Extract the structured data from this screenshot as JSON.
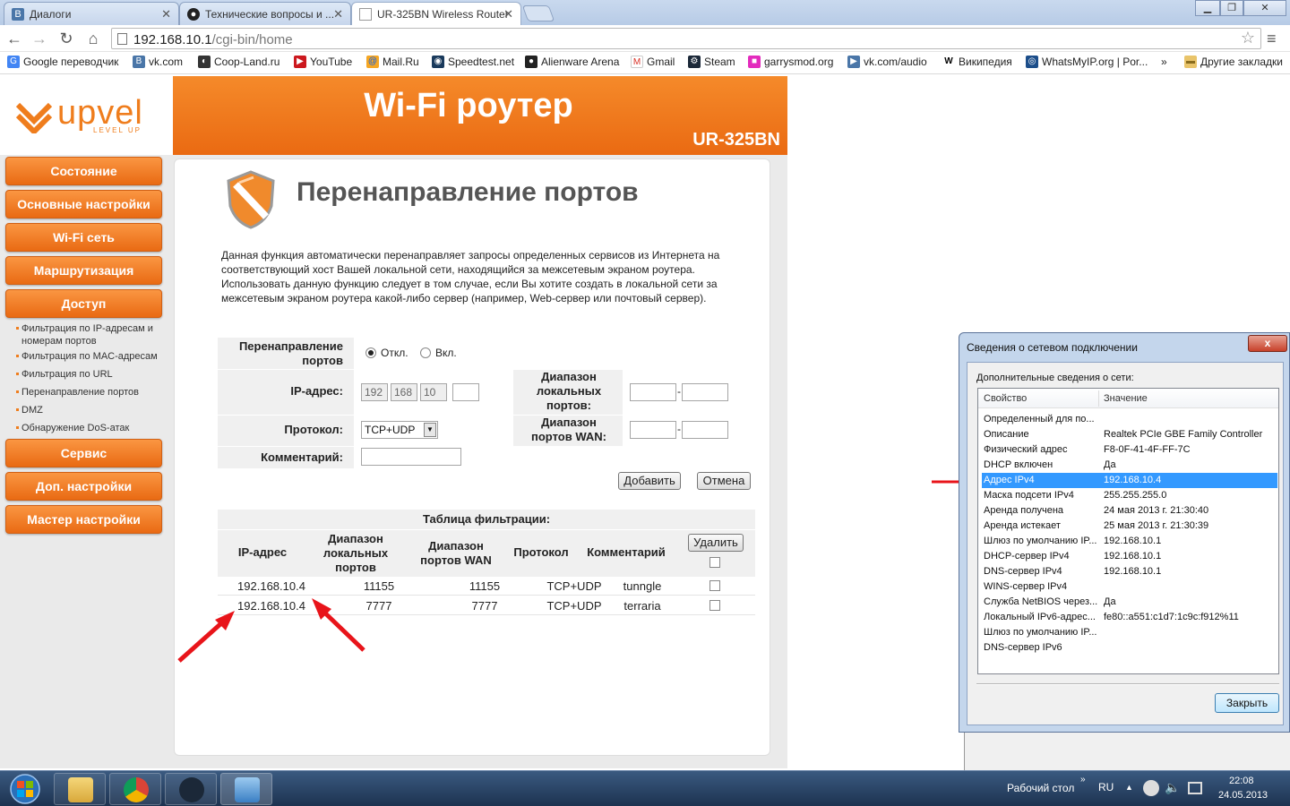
{
  "browser": {
    "tabs": [
      {
        "title": "Диалоги",
        "icon": "vk-icon"
      },
      {
        "title": "Технические вопросы и ...",
        "icon": "steam-icon"
      },
      {
        "title": "UR-325BN Wireless Router",
        "icon": "page-icon"
      }
    ],
    "url_host": "192.168.10.1",
    "url_path": "/cgi-bin/home",
    "bookmarks": [
      "Google переводчик",
      "vk.com",
      "Coop-Land.ru",
      "YouTube",
      "Mail.Ru",
      "Speedtest.net",
      "Alienware Arena",
      "Gmail",
      "Steam",
      "garrysmod.org",
      "vk.com/audio",
      "Википедия",
      "WhatsMyIP.org | Por...",
      "»",
      "Другие закладки"
    ]
  },
  "router": {
    "logo": "upvel",
    "logo_sub": "LEVEL UP",
    "header_title": "Wi-Fi роутер",
    "model": "UR-325BN",
    "menu": [
      "Состояние",
      "Основные настройки",
      "Wi-Fi сеть",
      "Маршрутизация",
      "Доступ"
    ],
    "submenu": [
      "Фильтрация по IP-адресам и номерам портов",
      "Фильтрация по MAC-адресам",
      "Фильтрация по URL",
      "Перенаправление портов",
      "DMZ",
      "Обнаружение DoS-атак"
    ],
    "menu2": [
      "Сервис",
      "Доп. настройки",
      "Мастер настройки"
    ],
    "page_title": "Перенаправление портов",
    "description": "Данная функция автоматически перенаправляет запросы определенных сервисов из Интернета на соответствующий хост Вашей локальной сети, находящийся за межсетевым экраном роутера. Использовать данную функцию следует в том случае, если Вы хотите создать в локальной сети за межсетевым экраном роутера какой-либо сервер (например, Web-сервер или почтовый сервер).",
    "form": {
      "forward_label": "Перенаправление портов",
      "off_label": "Откл.",
      "on_label": "Вкл.",
      "ip_label": "IP-адрес:",
      "ip": [
        "192",
        "168",
        "10",
        ""
      ],
      "local_range_label": "Диапазон локальных портов:",
      "protocol_label": "Протокол:",
      "protocol_value": "TCP+UDP",
      "wan_range_label": "Диапазон портов WAN:",
      "comment_label": "Комментарий:",
      "add": "Добавить",
      "cancel": "Отмена"
    },
    "table": {
      "caption": "Таблица фильтрации:",
      "headers": [
        "IP-адрес",
        "Диапазон локальных портов",
        "Диапазон портов WAN",
        "Протокол",
        "Комментарий"
      ],
      "delete": "Удалить",
      "rows": [
        [
          "192.168.10.4",
          "11155",
          "11155",
          "TCP+UDP",
          "tunngle"
        ],
        [
          "192.168.10.4",
          "7777",
          "7777",
          "TCP+UDP",
          "terraria"
        ]
      ]
    }
  },
  "dialog": {
    "title": "Сведения о сетевом подключении",
    "close": "x",
    "subtitle": "Дополнительные сведения о сети:",
    "col_property": "Свойство",
    "col_value": "Значение",
    "rows": [
      [
        "Определенный для по...",
        ""
      ],
      [
        "Описание",
        "Realtek PCIe GBE Family Controller"
      ],
      [
        "Физический адрес",
        "F8-0F-41-4F-FF-7C"
      ],
      [
        "DHCP включен",
        "Да"
      ],
      [
        "Адрес IPv4",
        "192.168.10.4"
      ],
      [
        "Маска подсети IPv4",
        "255.255.255.0"
      ],
      [
        "Аренда получена",
        "24 мая 2013 г. 21:30:40"
      ],
      [
        "Аренда истекает",
        "25 мая 2013 г. 21:30:39"
      ],
      [
        "Шлюз по умолчанию IP...",
        "192.168.10.1"
      ],
      [
        "DHCP-сервер IPv4",
        "192.168.10.1"
      ],
      [
        "DNS-сервер IPv4",
        "192.168.10.1"
      ],
      [
        "WINS-сервер IPv4",
        ""
      ],
      [
        "Служба NetBIOS через...",
        "Да"
      ],
      [
        "Локальный IPv6-адрес...",
        "fe80::a551:c1d7:1c9c:f912%11"
      ],
      [
        "Шлюз по умолчанию IP...",
        ""
      ],
      [
        "DNS-сервер IPv6",
        ""
      ]
    ],
    "selected_row": 4,
    "ok": "Закрыть"
  },
  "taskbar": {
    "desktop": "Рабочий стол",
    "lang": "RU",
    "time": "22:08",
    "date": "24.05.2013"
  },
  "colors": {
    "accent": "#ef7d1d",
    "selection": "#3399ff",
    "arrow": "#e8141a"
  }
}
